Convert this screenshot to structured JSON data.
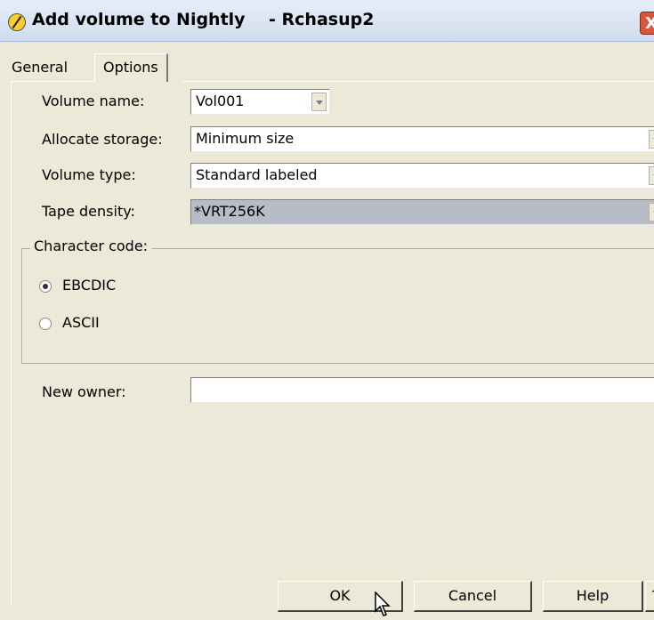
{
  "window": {
    "title": "Add volume to Nightly    - Rchasup2",
    "close_glyph": "X"
  },
  "tabs": [
    {
      "label": "General",
      "active": false
    },
    {
      "label": "Options",
      "active": true
    }
  ],
  "form": {
    "volume_name": {
      "label": "Volume name:",
      "value": "Vol001"
    },
    "allocate_storage": {
      "label": "Allocate storage:",
      "value": "Minimum size"
    },
    "volume_type": {
      "label": "Volume type:",
      "value": "Standard labeled"
    },
    "tape_density": {
      "label": "Tape density:",
      "value": "*VRT256K"
    },
    "character_code": {
      "legend": "Character code:",
      "options": [
        {
          "label": "EBCDIC",
          "checked": true
        },
        {
          "label": "ASCII",
          "checked": false
        }
      ]
    },
    "new_owner": {
      "label": "New owner:",
      "value": ""
    }
  },
  "buttons": {
    "ok": "OK",
    "cancel": "Cancel",
    "help": "Help",
    "question": "?"
  },
  "icons": {
    "title": "app-logo-icon",
    "close": "close-icon",
    "cursor": "mouse-pointer-icon"
  }
}
